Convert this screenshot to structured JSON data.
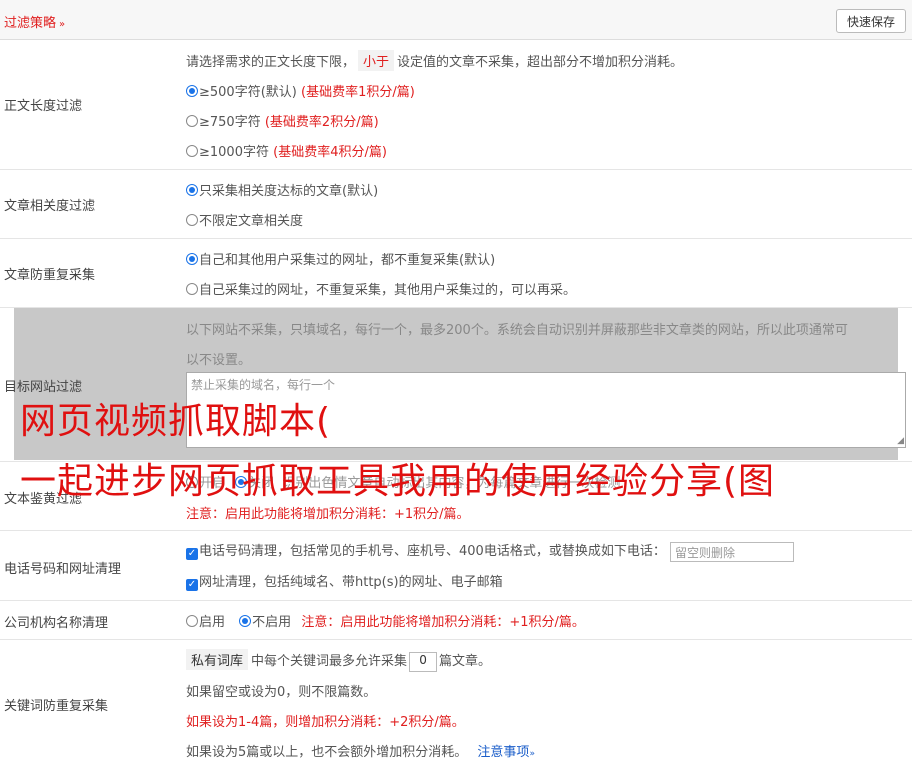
{
  "header": {
    "title": "过滤策略",
    "title_icon": "chevron-double-down-icon",
    "save_label": "快速保存"
  },
  "content_length": {
    "label": "正文长度过滤",
    "desc_before": "请选择需求的正文长度下限，",
    "desc_tag": "小于",
    "desc_after": "设定值的文章不采集，超出部分不增加积分消耗。",
    "options": [
      {
        "text": "≥500字符(默认)",
        "fee": "(基础费率1积分/篇)",
        "selected": true
      },
      {
        "text": "≥750字符",
        "fee": "(基础费率2积分/篇)",
        "selected": false
      },
      {
        "text": "≥1000字符",
        "fee": "(基础费率4积分/篇)",
        "selected": false
      }
    ]
  },
  "relevance": {
    "label": "文章相关度过滤",
    "options": [
      {
        "text": "只采集相关度达标的文章(默认)",
        "selected": true
      },
      {
        "text": "不限定文章相关度",
        "selected": false
      }
    ]
  },
  "dedupe": {
    "label": "文章防重复采集",
    "options": [
      {
        "text": "自己和其他用户采集过的网址，都不重复采集(默认)",
        "selected": true
      },
      {
        "text": "自己采集过的网址，不重复采集，其他用户采集过的，可以再采。",
        "selected": false
      }
    ]
  },
  "target_site": {
    "label": "目标网站过滤",
    "desc1": "以下网站不采集，只填域名，每行一个，最多200个。系统会自动识别并屏蔽那些非文章类的网站，所以此项通常可",
    "desc2": "以不设置。",
    "placeholder": "禁止采集的域名，每行一个"
  },
  "porn_filter": {
    "label": "文本鉴黄过滤",
    "on_label": "开启",
    "off_label": "关闭",
    "off_selected": true,
    "desc": "识别出色情文章自动标出其内容，为每篇文章进行一次检测",
    "note": "注意：启用此功能将增加积分消耗：+1积分/篇。"
  },
  "phone_url": {
    "label": "电话号码和网址清理",
    "phone_text": "电话号码清理，包括常见的手机号、座机号、400电话格式，或替换成如下电话：",
    "phone_placeholder": "留空则删除",
    "url_text": "网址清理，包括纯域名、带http(s)的网址、电子邮箱"
  },
  "company": {
    "label": "公司机构名称清理",
    "on_label": "启用",
    "off_label": "不启用",
    "off_selected": true,
    "note": "注意：启用此功能将增加积分消耗：+1积分/篇。"
  },
  "keyword_dedupe": {
    "label": "关键词防重复采集",
    "tag": "私有词库",
    "text_before": "中每个关键词最多允许采集",
    "count": "0",
    "text_after": "篇文章。",
    "line2": "如果留空或设为0，则不限篇数。",
    "line3": "如果设为1-4篇，则增加积分消耗：+2积分/篇。",
    "line4": "如果设为5篇或以上，也不会额外增加积分消耗。",
    "notes_link": "注意事项",
    "notes_icon": "chevron-double-down-icon"
  },
  "watermark": {
    "line1": "网页视频抓取脚本(",
    "line2": "一起进步网页抓取工具我用的使用经验分享(图"
  },
  "colors": {
    "accent": "#1a73e8",
    "warning": "#e02020",
    "link": "#1a5dc9",
    "overlay": "#c8c8c8"
  }
}
